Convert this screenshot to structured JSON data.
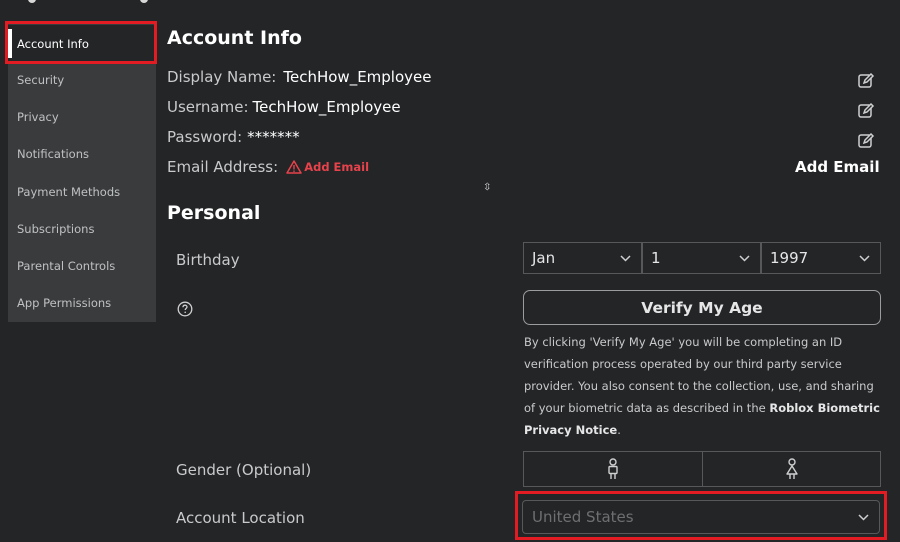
{
  "sidebar": {
    "items": [
      {
        "label": "Account Info"
      },
      {
        "label": "Security"
      },
      {
        "label": "Privacy"
      },
      {
        "label": "Notifications"
      },
      {
        "label": "Payment Methods"
      },
      {
        "label": "Subscriptions"
      },
      {
        "label": "Parental Controls"
      },
      {
        "label": "App Permissions"
      }
    ],
    "active_index": 0
  },
  "account_info": {
    "title": "Account Info",
    "display_name_label": "Display Name:",
    "display_name_value": "TechHow_Employee",
    "username_label": "Username:",
    "username_value": "TechHow_Employee",
    "password_label": "Password:",
    "password_value": "*******",
    "email_label": "Email Address:",
    "email_warning": "Add Email",
    "add_email_button": "Add Email"
  },
  "personal": {
    "title": "Personal",
    "birthday_label": "Birthday",
    "birthday_month": "Jan",
    "birthday_day": "1",
    "birthday_year": "1997",
    "verify_button": "Verify My Age",
    "disclaimer_text": "By clicking 'Verify My Age' you will be completing an ID verification process operated by our third party service provider. You also consent to the collection, use, and sharing of your biometric data as described in the ",
    "disclaimer_link": "Roblox Biometric Privacy Notice",
    "disclaimer_end": ".",
    "gender_label": "Gender (Optional)",
    "location_label": "Account Location",
    "location_value": "United States"
  },
  "colors": {
    "background": "#232527",
    "sidebar": "#393b3d",
    "highlight": "#e31b23",
    "warning": "#e8424b"
  },
  "icons": [
    "edit-icon",
    "warning-icon",
    "help-icon",
    "chevron-down-icon",
    "male-icon",
    "female-icon"
  ]
}
